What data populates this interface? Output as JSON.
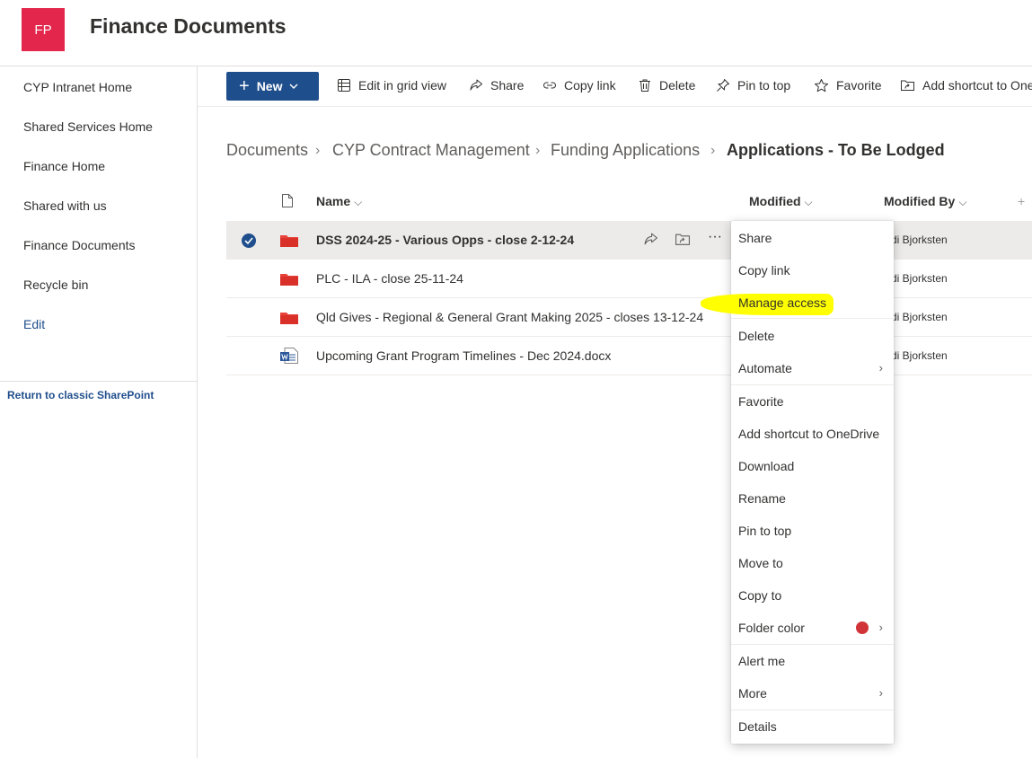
{
  "site": {
    "logo_initials": "FP",
    "title": "Finance Documents",
    "brand_color": "#e3264b",
    "accent_color": "#1f4e8c"
  },
  "leftnav": {
    "items": [
      {
        "label": "CYP Intranet Home"
      },
      {
        "label": "Shared Services Home"
      },
      {
        "label": "Finance Home"
      },
      {
        "label": "Shared with us"
      },
      {
        "label": "Finance Documents"
      },
      {
        "label": "Recycle bin"
      }
    ],
    "edit_label": "Edit",
    "classic_link": "Return to classic SharePoint"
  },
  "commandbar": {
    "new_label": "New",
    "edit_grid_label": "Edit in grid view",
    "share_label": "Share",
    "copy_link_label": "Copy link",
    "delete_label": "Delete",
    "pin_label": "Pin to top",
    "favorite_label": "Favorite",
    "add_shortcut_label": "Add shortcut to One"
  },
  "breadcrumb": {
    "items": [
      "Documents",
      "CYP Contract Management",
      "Funding Applications"
    ],
    "current": "Applications - To Be Lodged"
  },
  "list": {
    "headers": {
      "name": "Name",
      "modified": "Modified",
      "modified_by": "Modified By",
      "add_column": "+"
    },
    "rows": [
      {
        "name": "DSS 2024-25 - Various Opps - close 2-12-24",
        "type": "folder",
        "modified_by": "di Bjorksten",
        "selected": true
      },
      {
        "name": "PLC - ILA - close 25-11-24",
        "type": "folder",
        "modified_by": "di Bjorksten",
        "selected": false
      },
      {
        "name": "Qld Gives - Regional & General Grant Making 2025 - closes 13-12-24",
        "type": "folder",
        "modified_by": "di Bjorksten",
        "selected": false
      },
      {
        "name": "Upcoming Grant Program Timelines - Dec 2024.docx",
        "type": "word",
        "modified_by": "di Bjorksten",
        "selected": false
      }
    ],
    "folder_color": "#e8423a"
  },
  "context_menu": {
    "items": [
      {
        "label": "Share"
      },
      {
        "label": "Copy link"
      },
      {
        "label": "Manage access",
        "highlighted": true
      },
      {
        "label": "Delete"
      },
      {
        "label": "Automate",
        "submenu": true
      },
      {
        "label": "Favorite"
      },
      {
        "label": "Add shortcut to OneDrive"
      },
      {
        "label": "Download"
      },
      {
        "label": "Rename"
      },
      {
        "label": "Pin to top"
      },
      {
        "label": "Move to"
      },
      {
        "label": "Copy to"
      },
      {
        "label": "Folder color",
        "submenu": true,
        "swatch": "#d13438"
      },
      {
        "label": "Alert me"
      },
      {
        "label": "More",
        "submenu": true
      },
      {
        "label": "Details"
      }
    ],
    "highlight_color": "#ffff00"
  }
}
